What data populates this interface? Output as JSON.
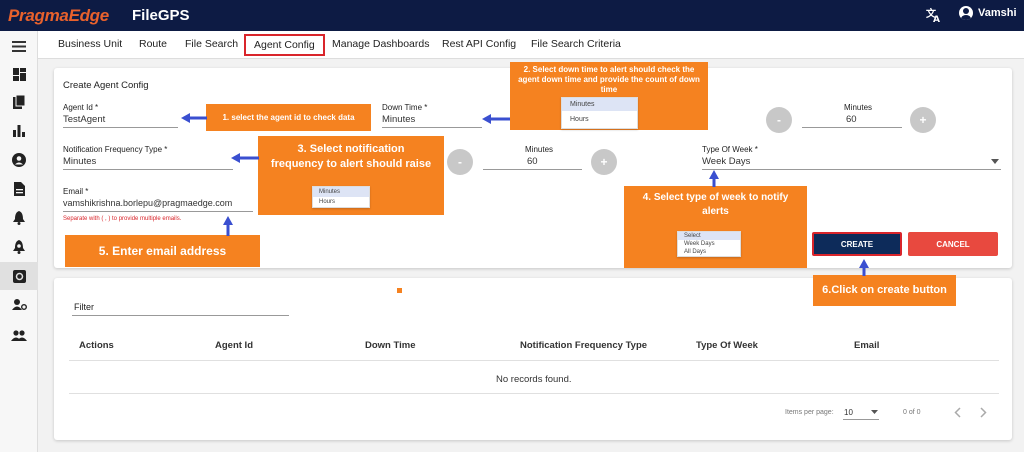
{
  "header": {
    "logo": "PragmaEdge",
    "app_name": "FileGPS",
    "translate_icon": "translate-icon",
    "user_name": "Vamshi"
  },
  "sidebar": {
    "icons": [
      "menu-icon",
      "dashboard-icon",
      "files-icon",
      "chart-icon",
      "account-icon",
      "document-icon",
      "alert-bell-icon",
      "alert-bell-settings-icon",
      "settings-active-icon",
      "user-settings-icon",
      "group-icon"
    ]
  },
  "nav": {
    "tabs": [
      "Business Unit",
      "Route",
      "File Search",
      "Agent Config",
      "Manage Dashboards",
      "Rest API Config",
      "File Search Criteria"
    ],
    "active": "Agent Config"
  },
  "form": {
    "title": "Create Agent Config",
    "agent_id_label": "Agent Id *",
    "agent_id_value": "TestAgent",
    "down_time_label": "Down Time *",
    "down_time_value": "Minutes",
    "minutes_label_1": "Minutes",
    "minutes_value_1": "60",
    "notif_label": "Notification Frequency Type *",
    "notif_value": "Minutes",
    "minutes_label_2": "Minutes",
    "minutes_value_2": "60",
    "week_label": "Type Of Week *",
    "week_value": "Week Days",
    "email_label": "Email *",
    "email_value": "vamshikrishna.borlepu@pragmaedge.com",
    "email_hint": "Separate with ( , ) to provide multiple emails.",
    "minus": "-",
    "plus": "+",
    "create_label": "CREATE",
    "cancel_label": "CANCEL"
  },
  "annotations": {
    "a1": "1. select the agent id to check data",
    "a2": "2. Select down time to alert should check the agent down time and provide the count of down time",
    "a2_options": [
      "Minutes",
      "Hours"
    ],
    "a3": "3. Select notification frequency to alert should raise",
    "a3_options": [
      "Minutes",
      "Hours"
    ],
    "a4": "4. Select type of week to notify alerts",
    "a4_options": [
      "Select",
      "Week Days",
      "All Days"
    ],
    "a5": "5. Enter email address",
    "a6": "6.Click on create button"
  },
  "table": {
    "filter_label": "Filter",
    "columns": [
      "Actions",
      "Agent Id",
      "Down Time",
      "Notification Frequency Type",
      "Type Of Week",
      "Email"
    ],
    "empty_text": "No records found.",
    "items_per_page_label": "Items per page:",
    "items_per_page_value": "10",
    "range": "0 of 0"
  },
  "colors": {
    "header_bg": "#0d1b44",
    "accent_orange": "#f58220",
    "create_btn": "#0d2b5a",
    "cancel_btn": "#e8493f",
    "highlight_border": "#d9252b"
  }
}
